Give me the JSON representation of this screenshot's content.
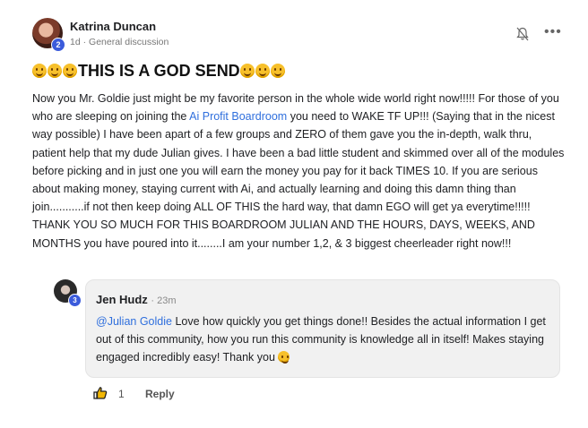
{
  "post": {
    "author": "Katrina Duncan",
    "level": "2",
    "time": "1d",
    "separator": "·",
    "category": "General discussion",
    "title": "THIS IS A GOD SEND",
    "body": {
      "part1": "Now you Mr. Goldie just might be my favorite person in the whole wide world right now!!!!! For those of you who are sleeping on joining the ",
      "link": "Ai Profit Boardroom",
      "part2": " you need to WAKE TF UP!!! (Saying that in the nicest way possible) I have been apart of a few groups and ZERO of them gave you the in-depth, walk thru, patient help that my dude Julian gives. I have been a bad little student and skimmed over all of the modules before picking and in just one you will earn the money you pay for it back TIMES 10. If you are serious about making money, staying current with Ai, and actually learning and doing this damn thing than join...........if not then keep doing ALL OF THIS the hard way, that damn EGO will get ya everytime!!!!! THANK YOU SO MUCH FOR THIS BOARDROOM JULIAN AND THE HOURS, DAYS, WEEKS, AND MONTHS you have poured into it........I am your number 1,2, & 3 biggest cheerleader right now!!!"
    },
    "icons": {
      "notifications": "bell-off-icon",
      "more": "more-options-icon"
    },
    "more_glyph": "•••"
  },
  "comment": {
    "author": "Jen Hudz",
    "time_sep": "·",
    "time": "23m",
    "level": "3",
    "mention": "@Julian Goldie",
    "text": " Love how quickly you get things done!! Besides the actual information I get out of this community, how you run this community is knowledge all in itself! Makes staying engaged incredibly easy! Thank you ",
    "likes": "1",
    "reply_label": "Reply"
  },
  "colors": {
    "link": "#2f6fdd",
    "badge": "#3b5bdb",
    "bubble": "#f1f1f1"
  }
}
